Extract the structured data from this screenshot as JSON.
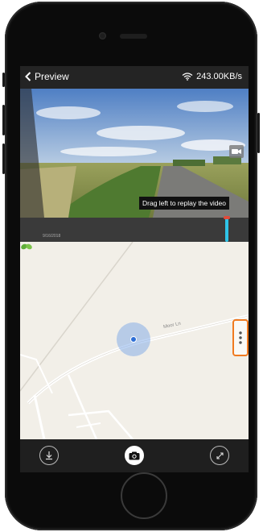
{
  "topbar": {
    "back_label": "Preview",
    "speed": "243.00KB/s"
  },
  "video": {
    "tooltip": "Drag left to replay the video"
  },
  "timeline": {
    "date": "9/16/2018"
  },
  "map": {
    "road_label": "Moor Ln"
  },
  "colors": {
    "accent_timeline": "#2fc4e8",
    "handle_border": "#f07a20",
    "location_dot": "#2e6fd6"
  },
  "icons": {
    "back": "chevron-left-icon",
    "wifi": "wifi-icon",
    "video_cam": "video-camera-icon",
    "leaf": "leaf-icon",
    "download": "download-icon",
    "camera": "camera-icon",
    "fullscreen": "expand-icon"
  }
}
